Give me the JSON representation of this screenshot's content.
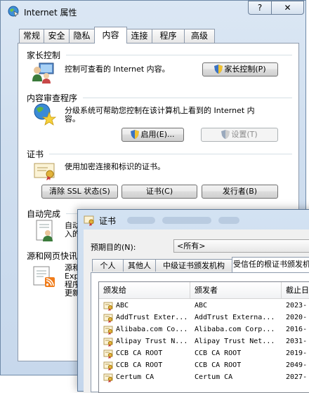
{
  "internet_options": {
    "title": "Internet 属性",
    "help_glyph": "?",
    "close_glyph": "✕",
    "tabs": [
      {
        "label": "常规"
      },
      {
        "label": "安全"
      },
      {
        "label": "隐私"
      },
      {
        "label": "内容"
      },
      {
        "label": "连接"
      },
      {
        "label": "程序"
      },
      {
        "label": "高级"
      }
    ],
    "active_tab": "内容",
    "parental": {
      "group_title": "家长控制",
      "description": "控制可查看的 Internet 内容。",
      "button": "家长控制(P)"
    },
    "advisor": {
      "group_title": "内容审查程序",
      "description_line1": "分级系统可帮助您控制在该计算机上看到的 Internet 内",
      "description_line2": "容。",
      "enable_button": "启用(E)...",
      "settings_button": "设置(T)"
    },
    "certificates": {
      "group_title": "证书",
      "description": "使用加密连接和标识的证书。",
      "clear_ssl_button": "清除 SSL 状态(S)",
      "certificates_button": "证书(C)",
      "publishers_button": "发行者(B)"
    },
    "autocomplete": {
      "group_title": "自动完成",
      "partial_line1": "自动",
      "partial_line2": "入的"
    },
    "feeds": {
      "group_title": "源和网页快讯",
      "partial_line1": "源和",
      "partial_line2": "Exp",
      "partial_line3": "程序",
      "partial_line4": "更新"
    }
  },
  "certificates_dialog": {
    "title": "证书",
    "purpose_label": "预期目的(N):",
    "purpose_value": "<所有>",
    "tabs": [
      {
        "label": "个人"
      },
      {
        "label": "其他人"
      },
      {
        "label": "中级证书颁发机构"
      },
      {
        "label": "受信任的根证书颁发机构"
      }
    ],
    "active_tab": "受信任的根证书颁发机构",
    "columns": [
      "颁发给",
      "颁发者",
      "截止日"
    ],
    "rows": [
      {
        "issued_to": "ABC",
        "issued_by": "ABC",
        "expires": "2023-"
      },
      {
        "issued_to": "AddTrust Exter...",
        "issued_by": "AddTrust Externa...",
        "expires": "2020-"
      },
      {
        "issued_to": "Alibaba.com Co...",
        "issued_by": "Alibaba.com Corp...",
        "expires": "2016-"
      },
      {
        "issued_to": "Alipay Trust N...",
        "issued_by": "Alipay Trust Net...",
        "expires": "2031-"
      },
      {
        "issued_to": "CCB CA ROOT",
        "issued_by": "CCB CA ROOT",
        "expires": "2019-"
      },
      {
        "issued_to": "CCB CA ROOT",
        "issued_by": "CCB CA ROOT",
        "expires": "2049-"
      },
      {
        "issued_to": "Certum CA",
        "issued_by": "Certum CA",
        "expires": "2027-"
      }
    ]
  }
}
